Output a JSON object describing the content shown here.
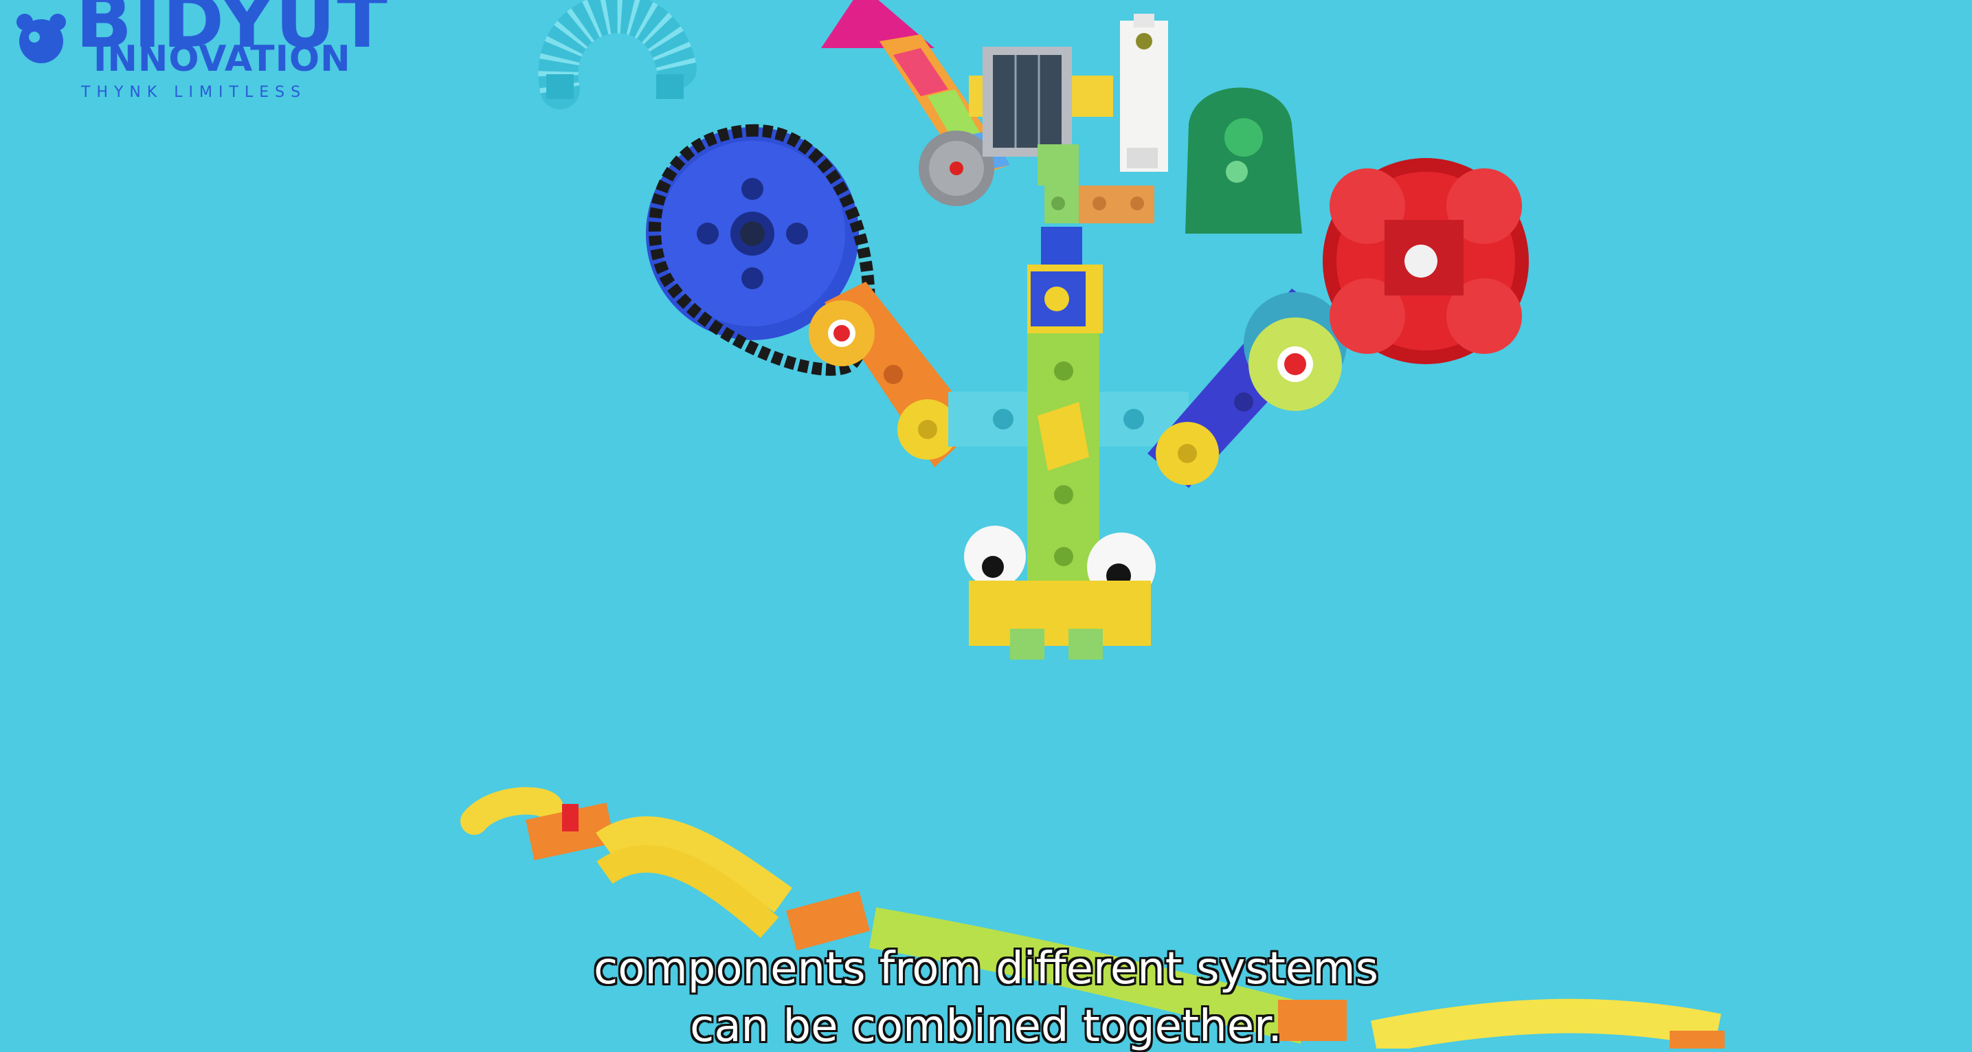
{
  "logo": {
    "brand_line1": "BIDYUT",
    "brand_line2": "INNOVATION",
    "tagline": "THYNK LIMITLESS"
  },
  "scene": {
    "background": "#4ccbe2",
    "objects": [
      "coil-tube",
      "pyramid-block",
      "rainbow-beam",
      "solar-panel",
      "sensor-module",
      "green-dome",
      "blue-gear",
      "chain-loop",
      "red-flower-wheel",
      "eyes",
      "wavy-track"
    ]
  },
  "caption": {
    "line1": "components from different systems",
    "line2": "can be combined together."
  },
  "colors": {
    "brand": "#2a5bd7",
    "gear": "#2e4fd6",
    "wheel": "#e3262c",
    "beam_green": "#9bd64b",
    "beam_cyan": "#5fd3e3",
    "yellow": "#f1d12d",
    "orange": "#f0862d"
  }
}
